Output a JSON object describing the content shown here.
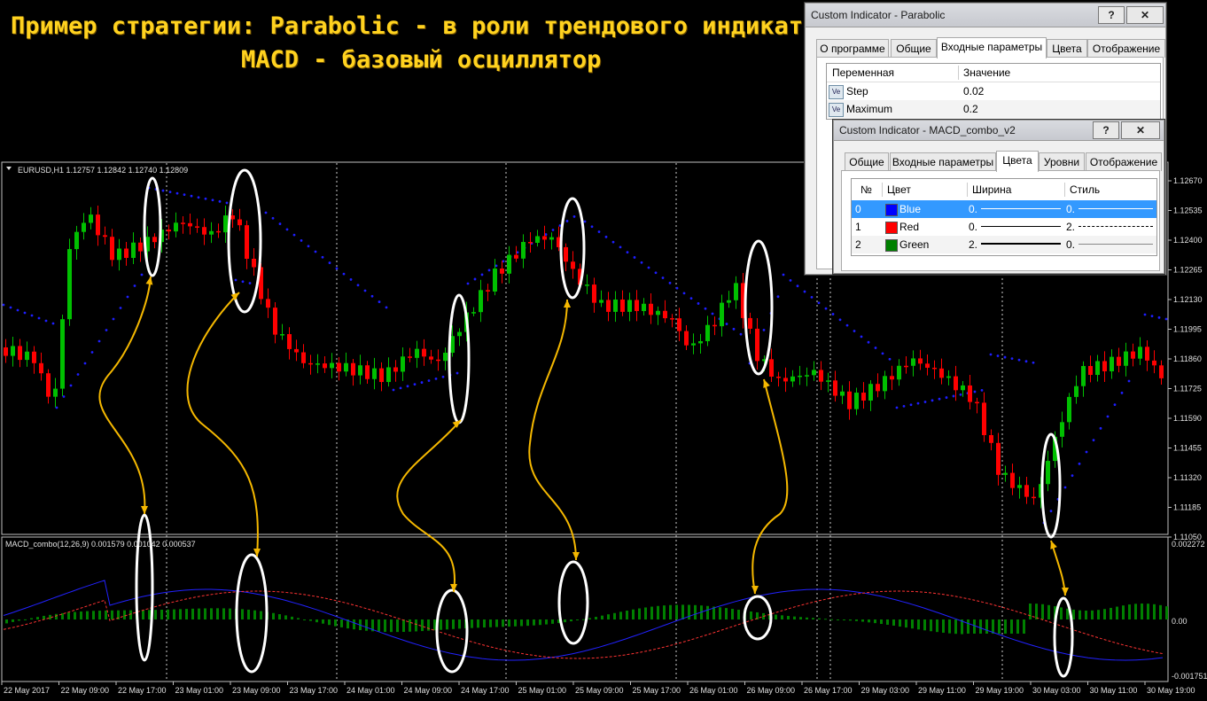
{
  "heading": {
    "line1": "Пример стратегии: Parabolic - в роли трендового индикатора",
    "line2": "MACD - базовый осциллятор"
  },
  "chart": {
    "symbol_info": "EURUSD,H1  1.12757 1.12842 1.12740 1.12809",
    "price_axis": [
      "1.12670",
      "1.12535",
      "1.12400",
      "1.12265",
      "1.12130",
      "1.11995",
      "1.11860",
      "1.11725",
      "1.11590",
      "1.11455",
      "1.11320",
      "1.11185",
      "1.11050"
    ],
    "macd_label": "MACD_combo(12,26,9) 0.001579 0.001042 0.000537",
    "macd_axis": [
      "0.002272",
      "0.00",
      "-0.001751"
    ],
    "time_axis": [
      "22 May 2017",
      "22 May 09:00",
      "22 May 17:00",
      "23 May 01:00",
      "23 May 09:00",
      "23 May 17:00",
      "24 May 01:00",
      "24 May 09:00",
      "24 May 17:00",
      "25 May 01:00",
      "25 May 09:00",
      "25 May 17:00",
      "26 May 01:00",
      "26 May 09:00",
      "26 May 17:00",
      "29 May 03:00",
      "29 May 11:00",
      "29 May 19:00",
      "30 May 03:00",
      "30 May 11:00",
      "30 May 19:00"
    ],
    "colors": {
      "bull": "#00C000",
      "bear": "#FF0000",
      "sar": "#1E1EFF",
      "signal": "#FF3333",
      "macd_line": "#2222FF",
      "hist": "#008000",
      "annot": "#F5B800"
    }
  },
  "parabolic_dialog": {
    "title": "Custom Indicator - Parabolic",
    "tabs": [
      "О программе",
      "Общие",
      "Входные параметры",
      "Цвета",
      "Отображение"
    ],
    "active_tab": "Входные параметры",
    "columns": [
      "Переменная",
      "Значение"
    ],
    "rows": [
      {
        "icon": "Ve",
        "name": "Step",
        "value": "0.02"
      },
      {
        "icon": "Ve",
        "name": "Maximum",
        "value": "0.2"
      }
    ]
  },
  "macd_dialog": {
    "title": "Custom Indicator - MACD_combo_v2",
    "tabs": [
      "Общие",
      "Входные параметры",
      "Цвета",
      "Уровни",
      "Отображение"
    ],
    "active_tab": "Цвета",
    "columns": [
      "№",
      "Цвет",
      "Ширина",
      "Стиль"
    ],
    "rows": [
      {
        "num": "0",
        "color_name": "Blue",
        "color": "#0000FF",
        "width": "0.",
        "style": "0."
      },
      {
        "num": "1",
        "color_name": "Red",
        "color": "#FF0000",
        "width": "0.",
        "style": "2."
      },
      {
        "num": "2",
        "color_name": "Green",
        "color": "#008000",
        "width": "2.",
        "style": "0."
      }
    ]
  },
  "window_buttons": {
    "help": "?",
    "close": "✕"
  }
}
